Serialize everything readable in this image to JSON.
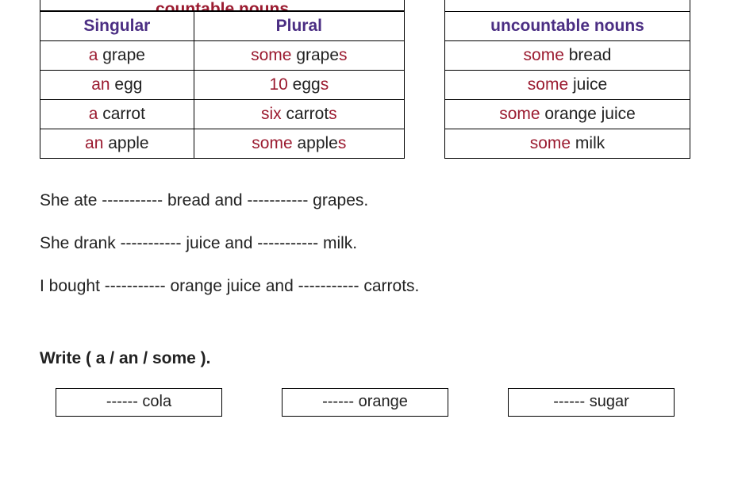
{
  "tables": {
    "countable": {
      "topHeader": "countable nouns",
      "singularHeader": "Singular",
      "pluralHeader": "Plural",
      "rows": [
        {
          "singPrefix": "a",
          "singWord": " grape",
          "pluPrefix": "some",
          "pluWord": " grape",
          "pluSuffix": "s"
        },
        {
          "singPrefix": "an",
          "singWord": " egg",
          "pluPrefix": "10",
          "pluWord": " egg",
          "pluSuffix": "s"
        },
        {
          "singPrefix": "a",
          "singWord": " carrot",
          "pluPrefix": "six",
          "pluWord": " carrot",
          "pluSuffix": "s"
        },
        {
          "singPrefix": "an",
          "singWord": " apple",
          "pluPrefix": "some",
          "pluWord": " apple",
          "pluSuffix": "s"
        }
      ]
    },
    "uncountable": {
      "header": "uncountable nouns",
      "rows": [
        {
          "prefix": "some",
          "word": " bread"
        },
        {
          "prefix": "some",
          "word": " juice"
        },
        {
          "prefix": "some",
          "word": " orange juice"
        },
        {
          "prefix": "some",
          "word": " milk"
        }
      ]
    }
  },
  "sentences": [
    "She ate ----------- bread and ----------- grapes.",
    "She drank ----------- juice and ----------- milk.",
    "I bought ----------- orange juice and ----------- carrots."
  ],
  "instruction": "Write ( a / an / some ).",
  "fillBoxes": [
    "------ cola",
    "------ orange",
    "------ sugar"
  ]
}
